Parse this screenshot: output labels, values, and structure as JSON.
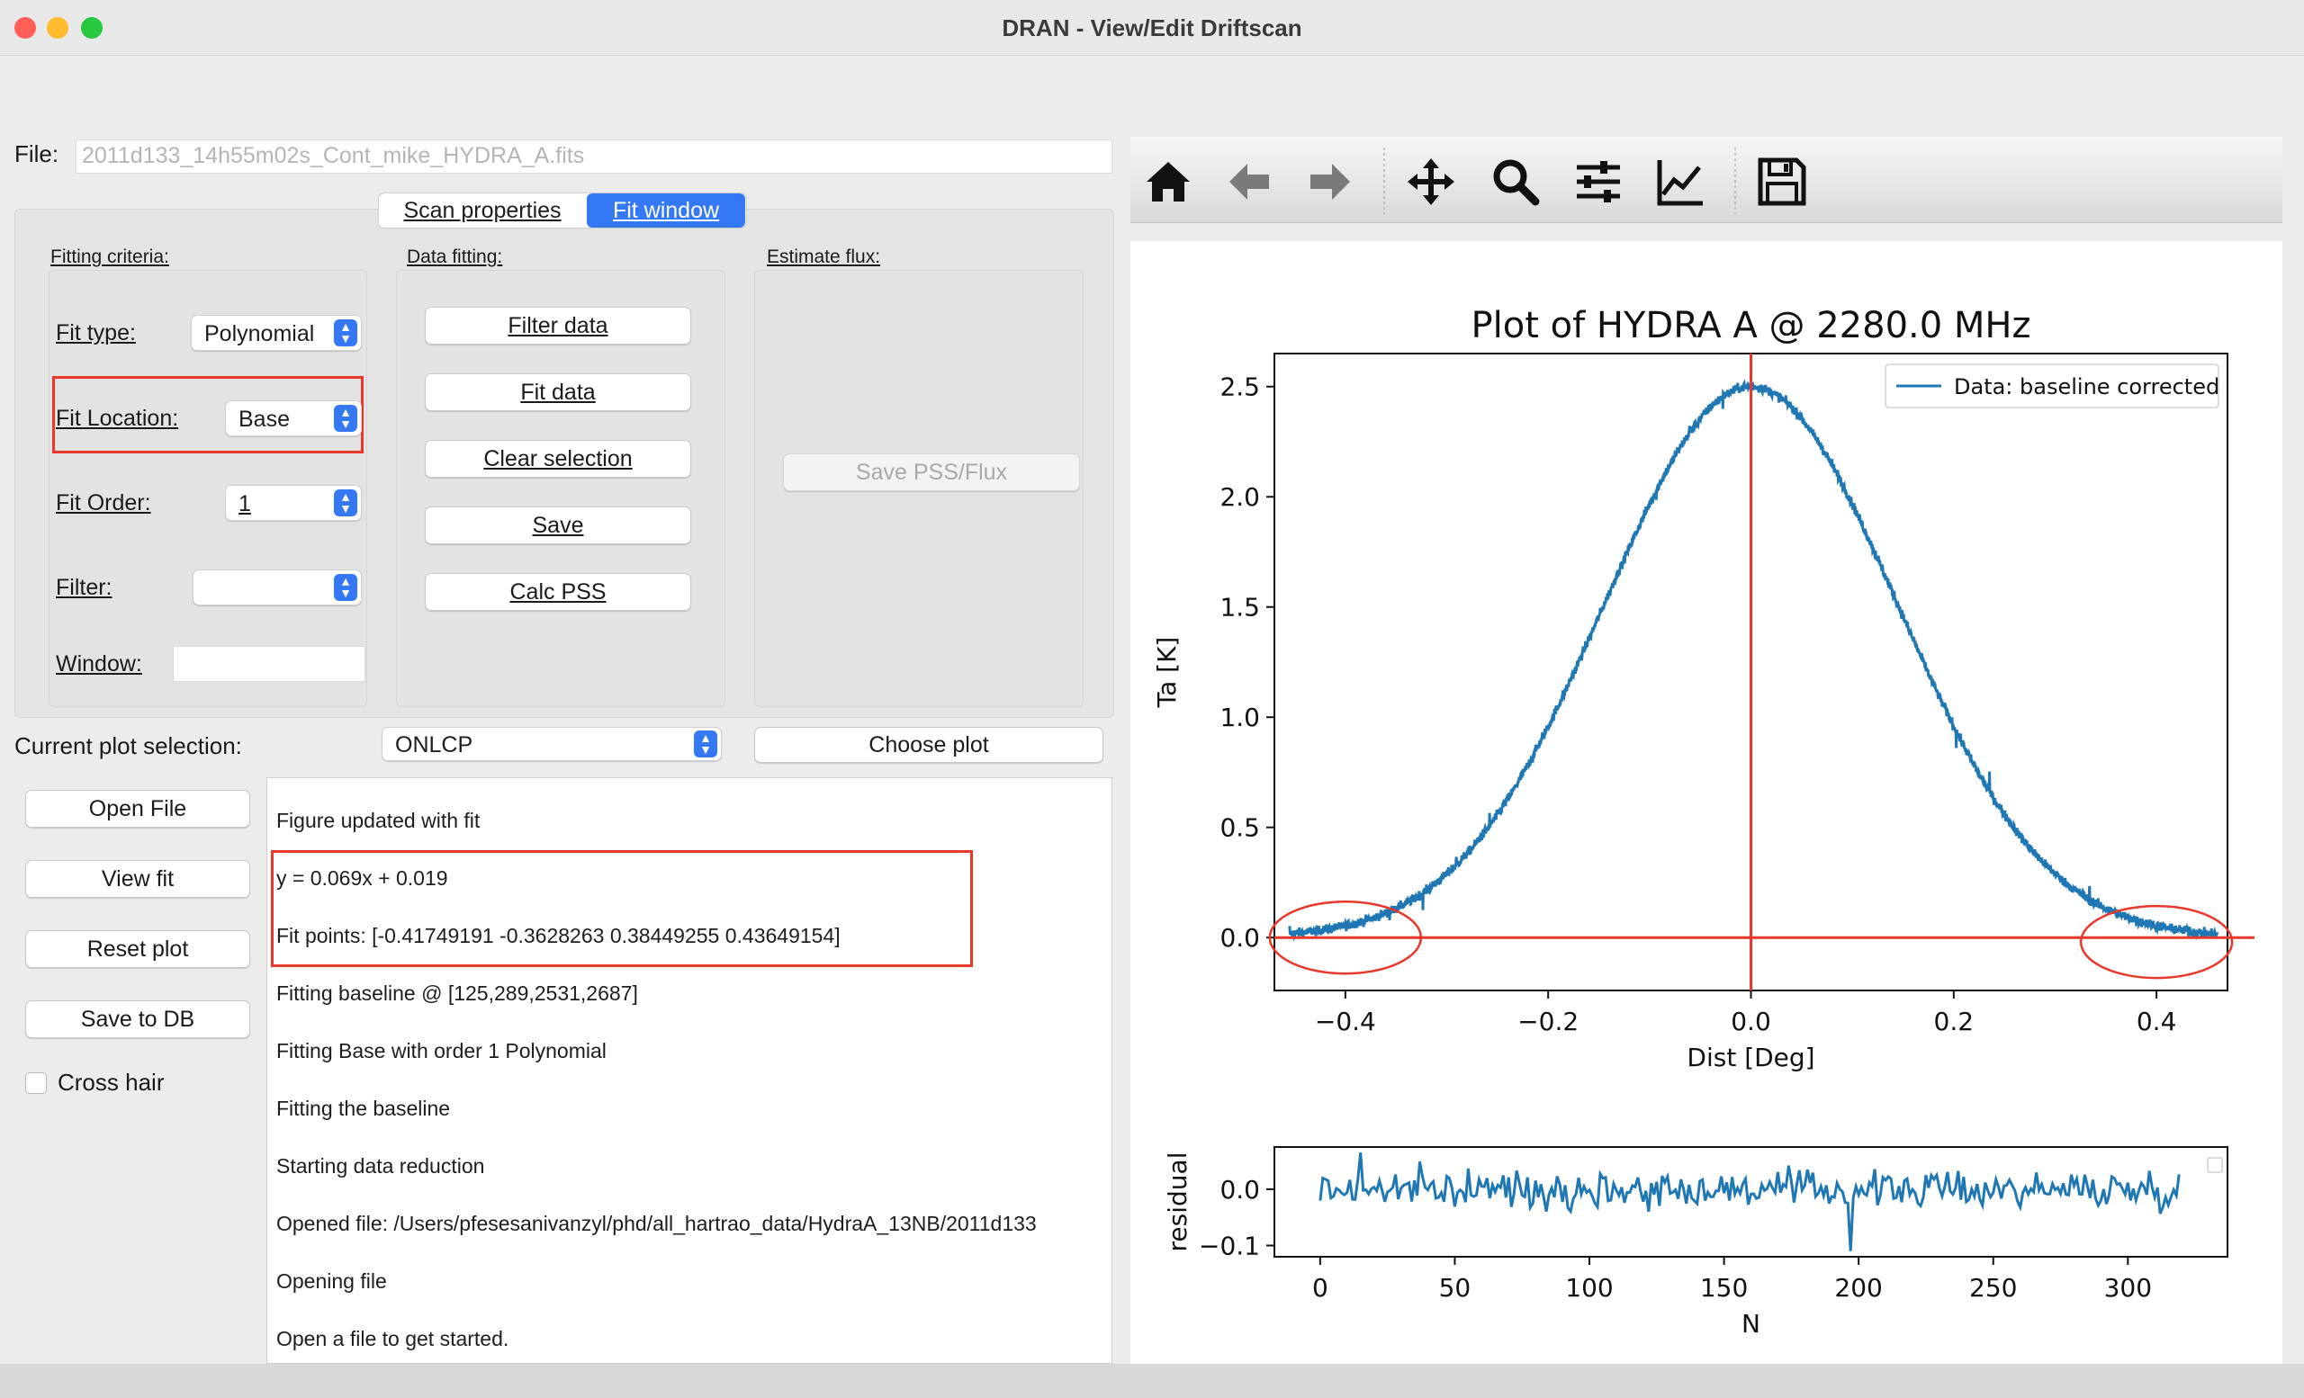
{
  "window": {
    "title": "DRAN - View/Edit Driftscan",
    "controls": {
      "close_color": "#ff5f57",
      "minimize_color": "#febc2e",
      "zoom_color": "#28c840"
    }
  },
  "file": {
    "label": "File:",
    "value": "2011d133_14h55m02s_Cont_mike_HYDRA_A.fits"
  },
  "tabs": [
    {
      "label": "Scan properties",
      "active": false
    },
    {
      "label": "Fit window",
      "active": true
    }
  ],
  "fitting": {
    "section_label": "Fitting criteria:",
    "fit_type_label": "Fit type:",
    "fit_type_value": "Polynomial",
    "fit_location_label": "Fit Location:",
    "fit_location_value": "Base",
    "fit_order_label": "Fit Order:",
    "fit_order_value": "1",
    "filter_label": "Filter:",
    "filter_value": "",
    "window_label": "Window:",
    "window_value": ""
  },
  "data_fitting": {
    "section_label": "Data fitting:",
    "buttons": [
      "Filter data",
      "Fit data",
      "Clear selection",
      "Save",
      "Calc PSS"
    ]
  },
  "estimate_flux": {
    "section_label": "Estimate flux:",
    "button": "Save PSS/Flux"
  },
  "plot_selection": {
    "label": "Current plot selection:",
    "value": "ONLCP",
    "choose_button": "Choose plot"
  },
  "side_buttons": [
    "Open File",
    "View fit",
    "Reset plot",
    "Save to DB"
  ],
  "crosshair": {
    "label": "Cross hair",
    "checked": false
  },
  "log": [
    "Figure updated with fit",
    "y = 0.069x + 0.019",
    "Fit points: [-0.41749191 -0.3628263   0.38449255  0.43649154]",
    "Fitting baseline @ [125,289,2531,2687]",
    "Fitting Base with order 1 Polynomial",
    "Fitting the baseline",
    "Starting data reduction",
    "Opened file: /Users/pfesesanivanzyl/phd/all_hartrao_data/HydraA_13NB/2011d133",
    "Opening file",
    "Open a file to get started."
  ],
  "toolbar_icons": [
    "home-icon",
    "back-arrow-icon",
    "forward-arrow-icon",
    "pan-icon",
    "zoom-icon",
    "configure-subplots-icon",
    "edit-axis-icon",
    "save-icon"
  ],
  "chart_data": [
    {
      "type": "line",
      "title": "Plot of HYDRA A @ 2280.0 MHz",
      "xlabel": "Dist [Deg]",
      "ylabel": "Ta [K]",
      "xlim": [
        -0.47,
        0.47
      ],
      "ylim": [
        -0.24,
        2.65
      ],
      "xticks": [
        "−0.4",
        "−0.2",
        "0.0",
        "0.2",
        "0.4"
      ],
      "yticks": [
        "0.0",
        "0.5",
        "1.0",
        "1.5",
        "2.0",
        "2.5"
      ],
      "legend": "top-right",
      "series": [
        {
          "name": "Data: baseline corrected",
          "color": "#1f77b4",
          "model": "gaussian",
          "peak": 2.5,
          "center": 0.0,
          "fwhm": 0.34,
          "x_range": [
            -0.455,
            0.46
          ]
        }
      ],
      "vline_x": 0.0,
      "hline_y": 0.0,
      "line_color": "#e8372b",
      "highlights": [
        "left baseline circle",
        "right baseline circle"
      ]
    },
    {
      "type": "line",
      "xlabel": "N",
      "ylabel": "residual",
      "xlim": [
        -17,
        337
      ],
      "ylim": [
        -0.12,
        0.075
      ],
      "xticks": [
        "0",
        "50",
        "100",
        "150",
        "200",
        "250",
        "300"
      ],
      "yticks": [
        "0.0",
        "−0.1"
      ],
      "series": [
        {
          "color": "#1f77b4",
          "n_points": 320,
          "noise_amplitude": 0.03,
          "dip_at": 197,
          "dip_value": -0.11
        }
      ]
    }
  ]
}
